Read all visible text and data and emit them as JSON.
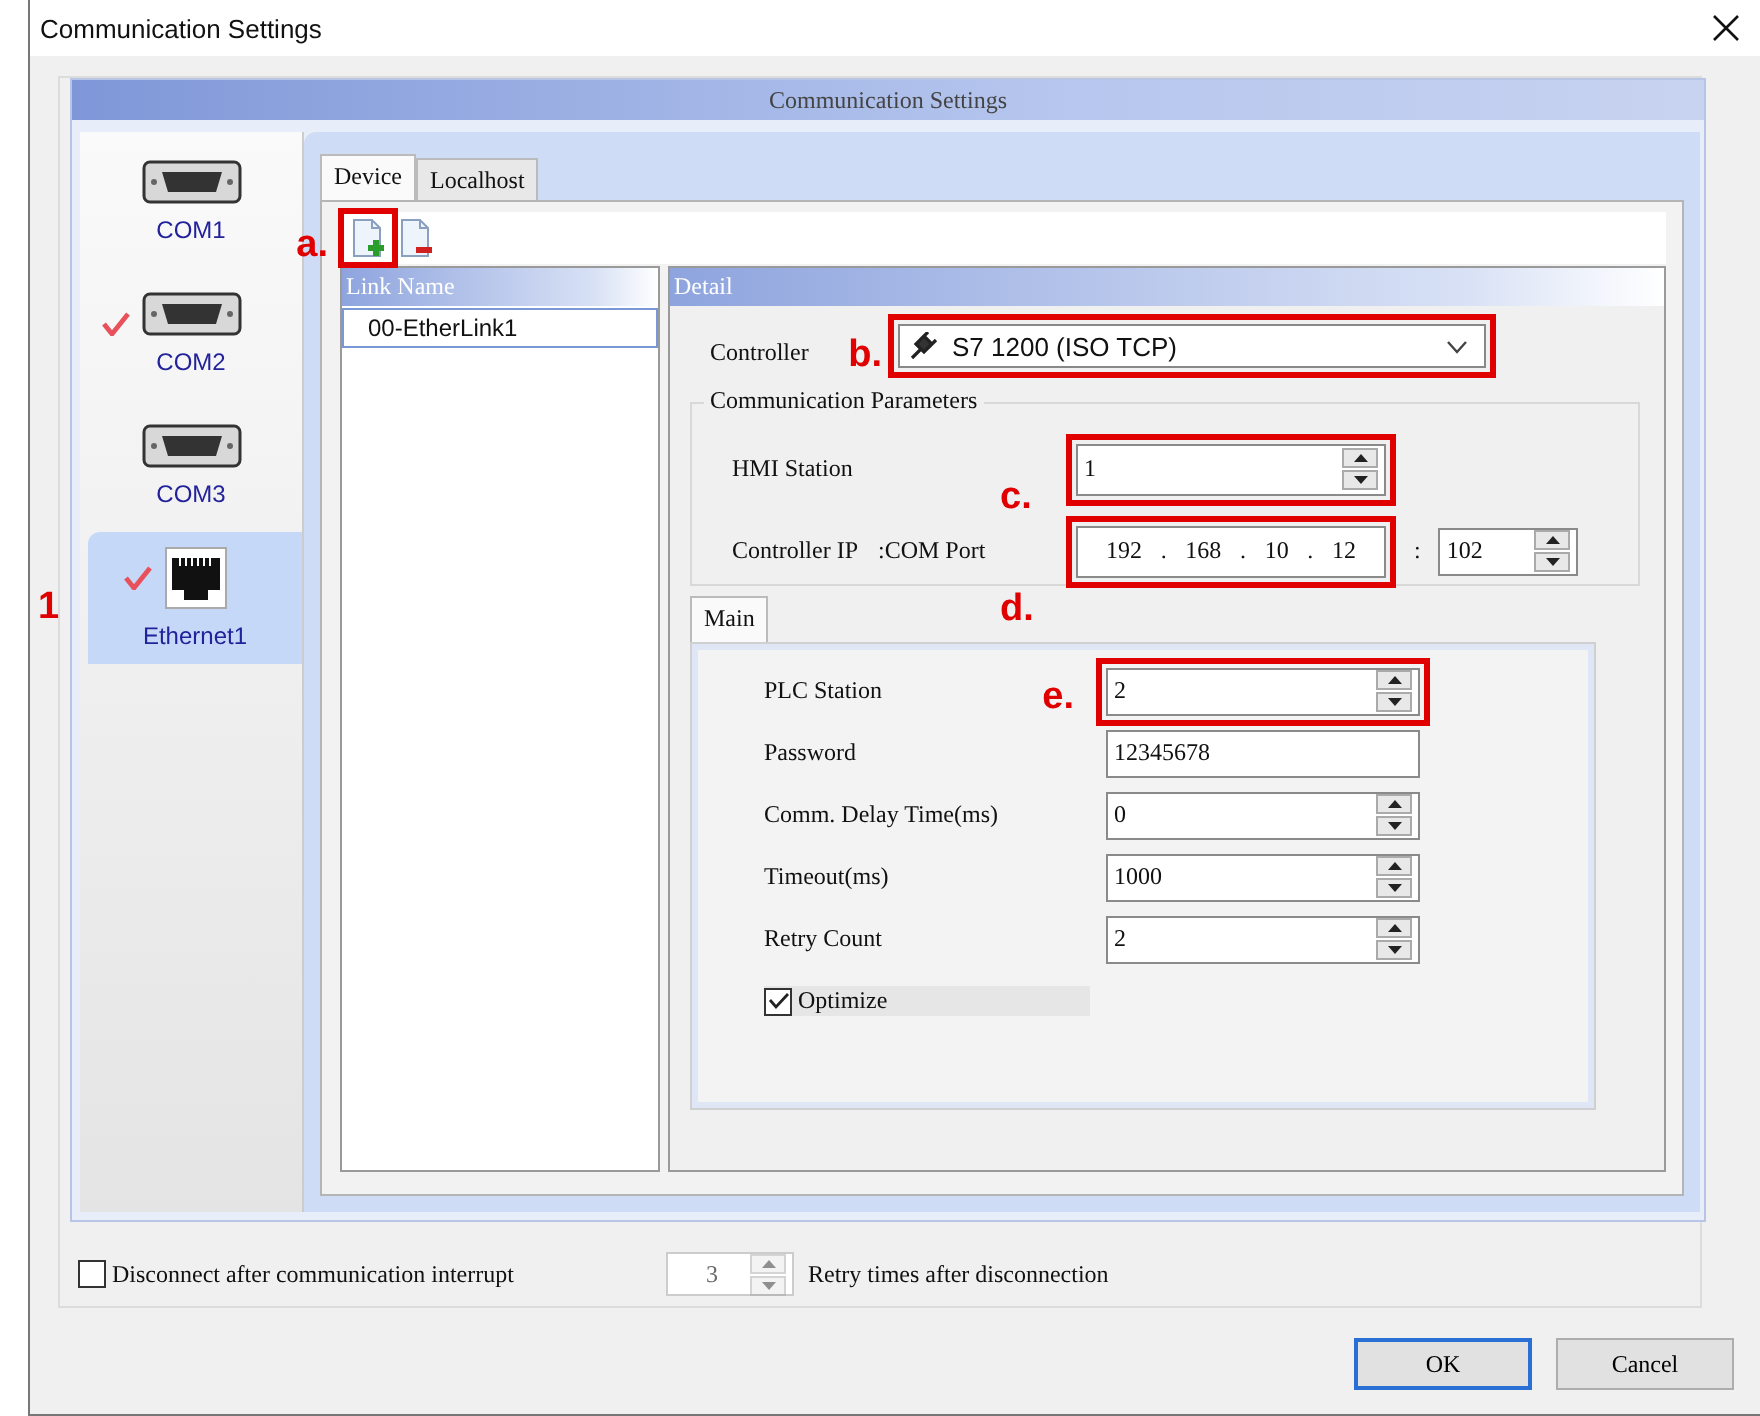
{
  "window": {
    "title": "Communication Settings"
  },
  "panel_title": "Communication Settings",
  "ports": [
    {
      "label": "COM1",
      "kind": "serial",
      "checked": false,
      "selected": false
    },
    {
      "label": "COM2",
      "kind": "serial",
      "checked": true,
      "selected": false
    },
    {
      "label": "COM3",
      "kind": "serial",
      "checked": false,
      "selected": false
    },
    {
      "label": "Ethernet1",
      "kind": "ethernet",
      "checked": true,
      "selected": true,
      "annotation": "1"
    }
  ],
  "tabs": [
    {
      "label": "Device",
      "selected": true
    },
    {
      "label": "Localhost",
      "selected": false
    }
  ],
  "toolbar": [
    {
      "kind": "add",
      "highlighted": true,
      "annotation": "a."
    },
    {
      "kind": "remove",
      "highlighted": false
    }
  ],
  "link_list": {
    "header": "Link Name",
    "items": [
      {
        "label": "00-EtherLink1",
        "selected": true
      }
    ]
  },
  "detail": {
    "header": "Detail",
    "controller": {
      "label": "Controller",
      "value": "S7 1200 (ISO TCP)",
      "highlighted": true,
      "annotation": "b."
    },
    "group": {
      "title": "Communication Parameters",
      "hmi_station": {
        "label": "HMI Station",
        "value": "1",
        "highlighted": true,
        "annotation": "c."
      },
      "controller_ip": {
        "label": "Controller IP",
        "port_label": ":COM Port",
        "octets": [
          "192",
          "168",
          "10",
          "12"
        ],
        "separators": [
          ".",
          ".",
          "."
        ],
        "highlighted": true,
        "annotation": "d.",
        "colon": ":",
        "port": "102"
      }
    },
    "sub_tabs": [
      {
        "label": "Main",
        "selected": true
      }
    ],
    "fields": [
      {
        "kind": "spin",
        "label": "PLC Station",
        "value": "2",
        "highlighted": true,
        "annotation": "e."
      },
      {
        "kind": "text",
        "label": "Password",
        "value": "12345678",
        "highlighted": false
      },
      {
        "kind": "spin",
        "label": "Comm. Delay Time(ms)",
        "value": "0",
        "highlighted": false
      },
      {
        "kind": "spin",
        "label": "Timeout(ms)",
        "value": "1000",
        "highlighted": false
      },
      {
        "kind": "spin",
        "label": "Retry Count",
        "value": "2",
        "highlighted": false
      },
      {
        "kind": "checkbox",
        "label": "Optimize",
        "checked": true
      }
    ]
  },
  "footer": {
    "disconnect": {
      "label": "Disconnect after communication interrupt",
      "checked": false
    },
    "retry": {
      "value": "3",
      "disabled": true,
      "label": "Retry times after disconnection"
    }
  },
  "buttons": [
    {
      "label": "OK",
      "default": true
    },
    {
      "label": "Cancel",
      "default": false
    }
  ]
}
